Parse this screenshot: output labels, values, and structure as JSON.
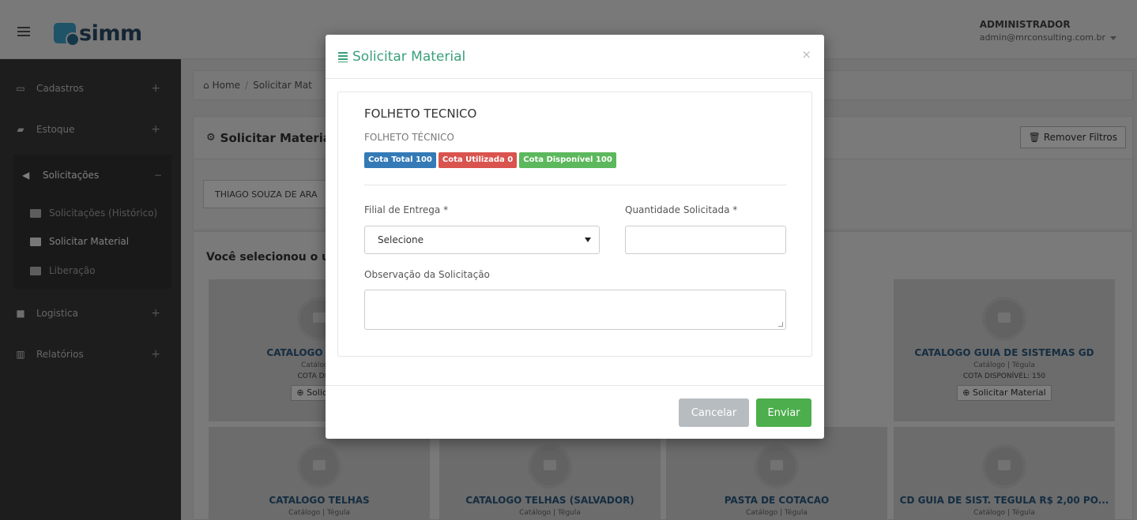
{
  "app": {
    "logo_text": "simm"
  },
  "user": {
    "name": "ADMINISTRADOR",
    "email": "admin@mrconsulting.com.br"
  },
  "sidebar": {
    "items": [
      {
        "label": "Cadastros",
        "toggle": "+"
      },
      {
        "label": "Estoque",
        "toggle": "+"
      },
      {
        "label": "Solicitações",
        "toggle": "−"
      },
      {
        "label": "Logistica",
        "toggle": "+"
      },
      {
        "label": "Relatórios",
        "toggle": "+"
      }
    ],
    "sub_items": [
      {
        "label": "Solicitações (Histórico)"
      },
      {
        "label": "Solicitar Material"
      },
      {
        "label": "Liberação"
      }
    ]
  },
  "breadcrumb": {
    "home": "Home",
    "sep": "/",
    "current": "Solicitar Mat"
  },
  "panel": {
    "title": "Solicitar Materia",
    "remove_filters": "Remover Filtros"
  },
  "filter": {
    "value": "THIAGO SOUZA DE ARA"
  },
  "selection": {
    "title": "Você selecionou o u"
  },
  "cards": [
    {
      "title": "CATALOGO SOLAR S",
      "meta": "Catálogo |",
      "cota": "COTA DISPO",
      "btn": "Solicitar"
    },
    {
      "title": "CATALOGO GUIA DE SISTEMAS GD",
      "meta": "Catálogo | Tégula",
      "cota": "COTA DISPONÍVEL: 150",
      "btn": "Solicitar Material"
    },
    {
      "title": "CATALOGO TELHAS",
      "meta": "Catálogo | Tégula"
    },
    {
      "title": "CATALOGO TELHAS (SALVADOR)",
      "meta": "Catálogo | Tégula"
    },
    {
      "title": "PASTA DE COTACAO",
      "meta": "Catálogo | Tégula"
    },
    {
      "title": "CD GUIA DE SIST. TEGULA R$ 2,00 PO...",
      "meta": "Catálogo | Tégula"
    }
  ],
  "modal": {
    "title": "Solicitar Material",
    "close": "×",
    "product_title": "FOLHETO TECNICO",
    "product_subtitle": "FOLHETO TÉCNICO",
    "badges": {
      "total": "Cota Total 100",
      "used": "Cota Utilizada 0",
      "available": "Cota Disponível 100"
    },
    "filial_label": "Filial de Entrega *",
    "filial_value": "Selecione",
    "quantidade_label": "Quantidade Solicitada *",
    "observacao_label": "Observação da Solicitação",
    "cancel": "Cancelar",
    "send": "Enviar"
  },
  "colors": {
    "accent": "#3aa07a",
    "blue_badge": "#337ab7",
    "red_badge": "#d9534f",
    "green_badge": "#5cb85c"
  }
}
